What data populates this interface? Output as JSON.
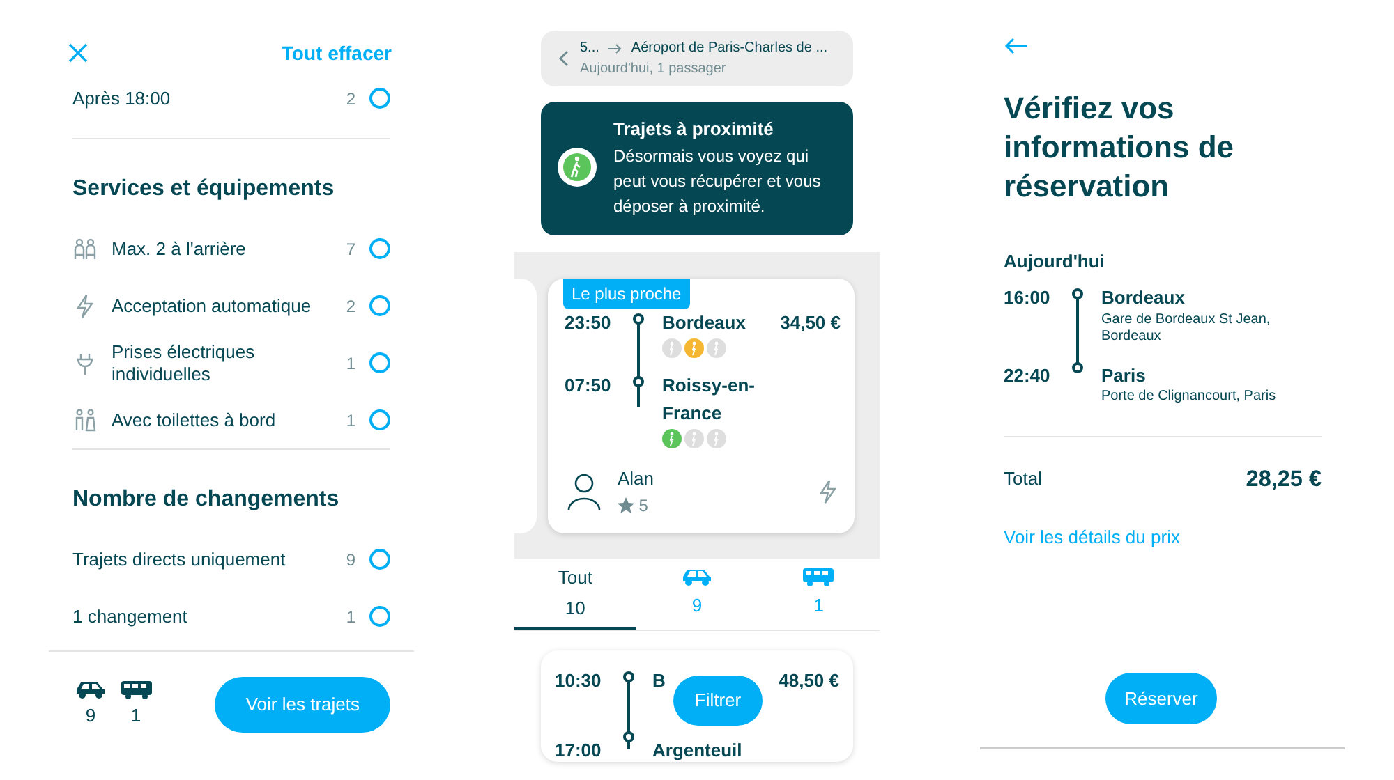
{
  "filters": {
    "clear_label": "Tout effacer",
    "sections": [
      {
        "items": [
          {
            "kind": "plain",
            "label": "Après 18:00",
            "count": "2",
            "checked": false
          }
        ]
      },
      {
        "title": "Services et équipements",
        "items": [
          {
            "kind": "seats",
            "label": "Max. 2 à l'arrière",
            "count": "7",
            "checked": false
          },
          {
            "kind": "lightning",
            "label": "Acceptation automatique",
            "count": "2",
            "checked": false
          },
          {
            "kind": "plug",
            "label": "Prises électriques individuelles",
            "count": "1",
            "checked": false
          },
          {
            "kind": "toilet",
            "label": "Avec toilettes à bord",
            "count": "1",
            "checked": false
          }
        ]
      },
      {
        "title": "Nombre de changements",
        "items": [
          {
            "kind": "plain",
            "label": "Trajets directs uniquement",
            "count": "9",
            "checked": false
          },
          {
            "kind": "plain",
            "label": "1 changement",
            "count": "1",
            "checked": false
          }
        ]
      }
    ],
    "footer": {
      "counts": [
        {
          "kind": "car",
          "count": "9"
        },
        {
          "kind": "bus",
          "count": "1"
        }
      ],
      "button": "Voir les trajets"
    }
  },
  "results": {
    "search": {
      "route_from": "5...",
      "route_to": "Aéroport de Paris-Charles de ...",
      "subtitle": "Aujourd'hui, 1 passager"
    },
    "banner": {
      "title": "Trajets à proximité",
      "text": "Désormais vous voyez qui peut vous récupérer et vous déposer à proximité."
    },
    "featured_trip": {
      "badge": "Le plus proche",
      "price": "34,50 €",
      "stops": [
        {
          "time": "23:50",
          "city": "Bordeaux",
          "proximity": [
            {
              "color": "#dedede"
            },
            {
              "color": "#f5b731"
            },
            {
              "color": "#dedede"
            }
          ]
        },
        {
          "time": "07:50",
          "city": "Roissy-en-France",
          "proximity": [
            {
              "color": "#5bc45b"
            },
            {
              "color": "#dedede"
            },
            {
              "color": "#dedede"
            }
          ]
        }
      ],
      "driver": {
        "name": "Alan",
        "rating": "5"
      }
    },
    "tabs": [
      {
        "kind": "all",
        "label": "Tout",
        "count": "10",
        "selected": true
      },
      {
        "kind": "car",
        "count": "9",
        "selected": false
      },
      {
        "kind": "bus",
        "count": "1",
        "selected": false
      }
    ],
    "next_trip": {
      "price": "48,50 €",
      "stops": [
        {
          "time": "10:30",
          "city": "B"
        },
        {
          "time": "17:00",
          "city": "Argenteuil"
        }
      ]
    },
    "filter_button": "Filtrer"
  },
  "booking": {
    "title": "Vérifiez vos informations de réservation",
    "date": "Aujourd'hui",
    "stops": [
      {
        "time": "16:00",
        "city": "Bordeaux",
        "address": "Gare de Bordeaux St Jean, Bordeaux"
      },
      {
        "time": "22:40",
        "city": "Paris",
        "address": "Porte de Clignancourt, Paris"
      }
    ],
    "total_label": "Total",
    "total": "28,25 €",
    "price_link": "Voir les détails du prix",
    "button": "Réserver"
  }
}
